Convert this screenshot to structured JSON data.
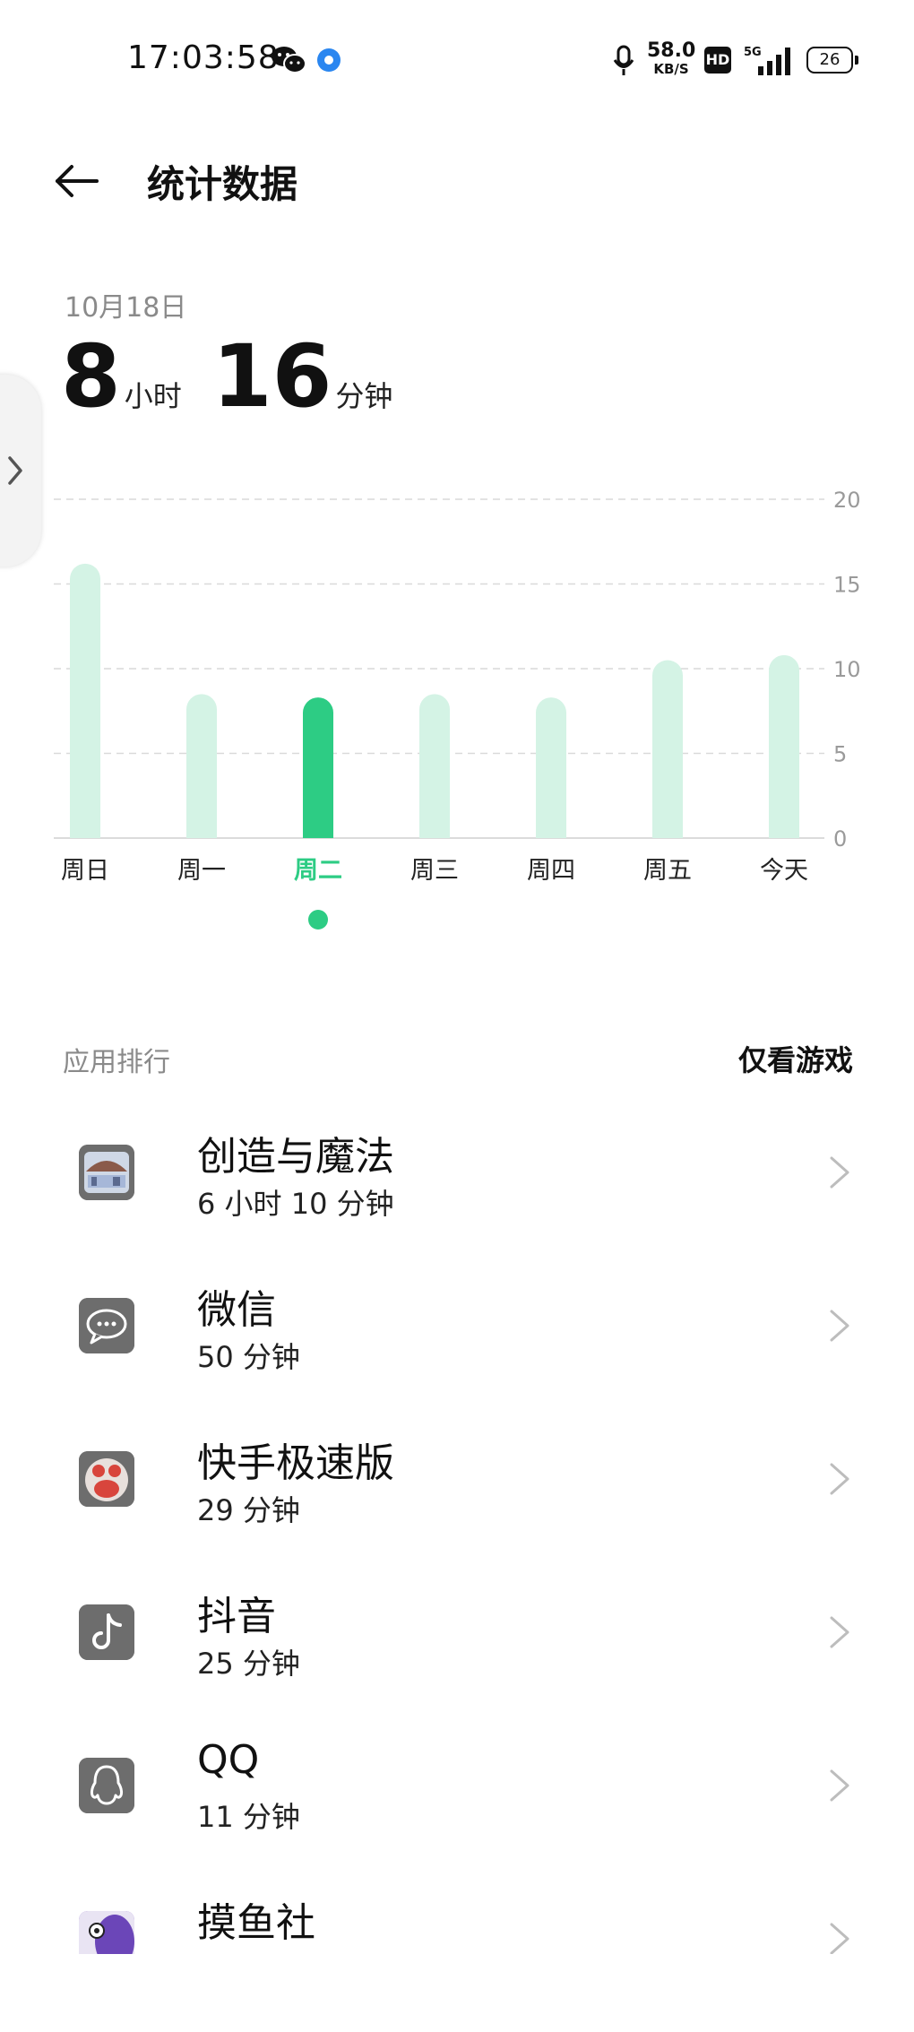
{
  "status_bar": {
    "time": "17:03:58",
    "net_speed_value": "58.0",
    "net_speed_unit": "KB/S",
    "hd": "HD",
    "network": "5G",
    "battery": "26"
  },
  "header": {
    "title": "统计数据"
  },
  "summary": {
    "date": "10月18日",
    "hours": "8",
    "hours_unit": "小时",
    "minutes": "16",
    "minutes_unit": "分钟"
  },
  "chart_data": {
    "type": "bar",
    "categories": [
      "周日",
      "周一",
      "周二",
      "周三",
      "周四",
      "周五",
      "今天"
    ],
    "values": [
      16.2,
      8.5,
      8.3,
      8.5,
      8.3,
      10.5,
      10.8
    ],
    "selected_index": 2,
    "ylim": [
      0,
      20
    ],
    "yticks": [
      "20",
      "15",
      "10",
      "5",
      "0"
    ],
    "grid": true,
    "colors": {
      "bar": "#d4f3e5",
      "selected": "#2dcc84",
      "grid": "#d9d9d9",
      "tick": "#9a9a9a"
    }
  },
  "ranking": {
    "label": "应用排行",
    "games_only": "仅看游戏",
    "apps": [
      {
        "name": "创造与魔法",
        "time": "6 小时 10 分钟",
        "icon": "game-icon"
      },
      {
        "name": "微信",
        "time": "50 分钟",
        "icon": "wechat-icon"
      },
      {
        "name": "快手极速版",
        "time": "29 分钟",
        "icon": "kuaishou-icon"
      },
      {
        "name": "抖音",
        "time": "25 分钟",
        "icon": "douyin-icon"
      },
      {
        "name": "QQ",
        "time": "11 分钟",
        "icon": "qq-icon"
      },
      {
        "name": "摸鱼社",
        "time": "",
        "icon": "moyushe-icon"
      }
    ]
  }
}
